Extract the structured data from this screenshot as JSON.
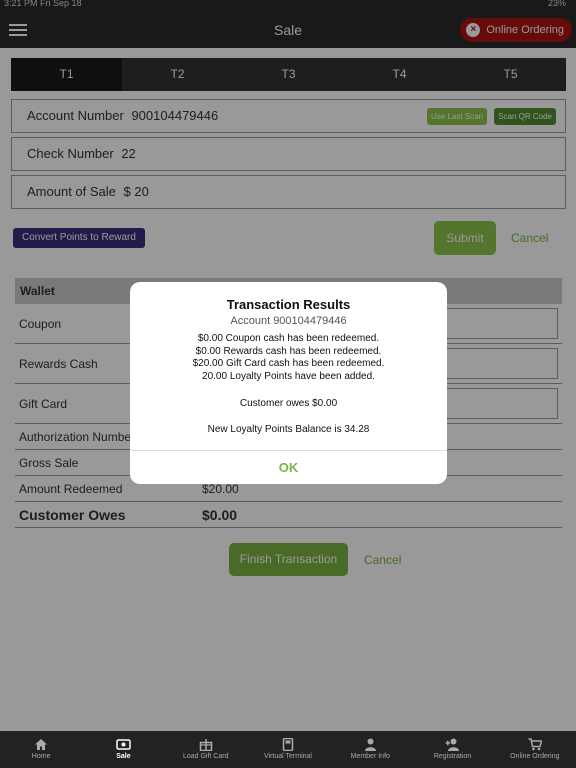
{
  "status": {
    "time": "3:21 PM  Fri Sep 18",
    "battery": "23%"
  },
  "nav": {
    "title": "Sale",
    "online_ordering": "Online Ordering"
  },
  "tabs": [
    "T1",
    "T2",
    "T3",
    "T4",
    "T5"
  ],
  "form": {
    "account_label": "Account Number",
    "account_value": "900104479446",
    "use_last_scan": "Use Last Scan",
    "scan_qr": "Scan QR Code",
    "check_label": "Check Number",
    "check_value": "22",
    "amount_label": "Amount of Sale",
    "amount_value": "$ 20",
    "convert_btn": "Convert Points to Reward",
    "submit": "Submit",
    "cancel": "Cancel"
  },
  "wallet": {
    "header": "Wallet",
    "rows": [
      "Coupon",
      "Rewards Cash",
      "Gift Card"
    ]
  },
  "summary": {
    "auth_label": "Authorization Numbe",
    "gross_label": "Gross Sale",
    "redeemed_label": "Amount Redeemed",
    "redeemed_value": "$20.00",
    "owes_label": "Customer Owes",
    "owes_value": "$0.00"
  },
  "actions": {
    "finish": "Finish Transaction",
    "cancel": "Cancel"
  },
  "modal": {
    "title": "Transaction Results",
    "account": "Account 900104479446",
    "lines": [
      "$0.00 Coupon cash has been redeemed.",
      "$0.00 Rewards cash has been redeemed.",
      "$20.00 Gift Card cash has been redeemed.",
      "20.00 Loyalty Points have been added."
    ],
    "owes": "Customer owes $0.00",
    "balance": "New Loyalty Points Balance is 34.28",
    "ok": "OK"
  },
  "tabbar": [
    "Home",
    "Sale",
    "Load Gift Card",
    "Virtual Terminal",
    "Member Info",
    "Registration",
    "Online Ordering"
  ],
  "colors": {
    "accent": "#7cb342",
    "dark": "#2b2b2b",
    "alert": "#aa1111",
    "purple": "#3b2d7a"
  }
}
